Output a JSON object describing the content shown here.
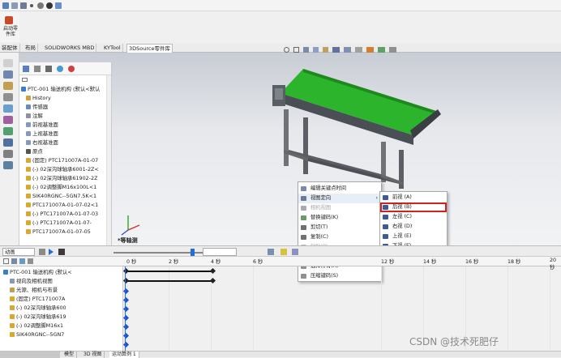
{
  "toolbar_top": {
    "toolbox_label_1": "启动零",
    "toolbox_label_2": "件库"
  },
  "tabs": [
    "装配体",
    "布局",
    "SOLIDWORKS MBD",
    "KYTool",
    "3DSource零件库"
  ],
  "feature_tree": {
    "items": [
      {
        "label": "PTC-001 输送机构 (默认<默认",
        "indent": 0
      },
      {
        "label": "History",
        "indent": 1
      },
      {
        "label": "传感器",
        "indent": 1
      },
      {
        "label": "注解",
        "indent": 1
      },
      {
        "label": "前视基准面",
        "indent": 1
      },
      {
        "label": "上视基准面",
        "indent": 1
      },
      {
        "label": "右视基准面",
        "indent": 1
      },
      {
        "label": "原点",
        "indent": 1
      },
      {
        "label": "(固定) PTC171007A-01-07",
        "indent": 1
      },
      {
        "label": "(-) 02深沟球轴承6001-2Z<",
        "indent": 1
      },
      {
        "label": "(-) 02深沟球轴承61902-2Z",
        "indent": 1
      },
      {
        "label": "(-) 02调整脚M16x100L<1",
        "indent": 1
      },
      {
        "label": "SIK40RGNC--5GN7.5K<1",
        "indent": 1
      },
      {
        "label": "PTC171007A-01-07-02<1",
        "indent": 1
      },
      {
        "label": "(-) PTC171007A-01-07-03",
        "indent": 1
      },
      {
        "label": "(-) PTC171007A-01-07-",
        "indent": 1
      },
      {
        "label": "PTC171007A-01-07-05",
        "indent": 1
      }
    ]
  },
  "viewport": {
    "view_label": "*等轴测"
  },
  "context_menu": {
    "items": [
      {
        "label": "编辑关键点时间",
        "disabled": false
      },
      {
        "label": "视图定向",
        "disabled": false,
        "submenu": true
      },
      {
        "label": "相机视图",
        "disabled": true
      },
      {
        "label": "替换键码(K)",
        "disabled": false
      },
      {
        "label": "剪切(T)",
        "disabled": false
      },
      {
        "label": "复制(C)",
        "disabled": false
      },
      {
        "label": "粘贴(P)",
        "disabled": true
      },
      {
        "label": "删除(D)",
        "disabled": false
      },
      {
        "label": "选择所有(A)",
        "disabled": false
      },
      {
        "label": "压缩键码(S)",
        "disabled": false
      }
    ]
  },
  "submenu": {
    "items": [
      {
        "label": "前视 (A)",
        "highlighted": false
      },
      {
        "label": "后视 (B)",
        "highlighted": true
      },
      {
        "label": "左视 (C)",
        "highlighted": false
      },
      {
        "label": "右视 (D)",
        "highlighted": false
      },
      {
        "label": "上视 (E)",
        "highlighted": false
      },
      {
        "label": "下视 (F)",
        "highlighted": false
      },
      {
        "label": "等轴测 (G)",
        "highlighted": false
      }
    ]
  },
  "animation": {
    "mode": "动画",
    "timeline_labels": [
      "0 秒",
      "2 秒",
      "4 秒",
      "6 秒",
      "12 秒",
      "14 秒",
      "16 秒",
      "18 秒",
      "20 秒"
    ],
    "tree_items": [
      "PTC-001 输送机构 (默认<",
      "视向及相机视图",
      "光源、相机与布景",
      "(固定) PTC171007A",
      "(-) 02深沟球轴承600",
      "(-) 02深沟球轴承619",
      "(-) 02调整脚M16x1",
      "SIK40RGNC--5GN7"
    ]
  },
  "status_tabs": [
    "模型",
    "3D 视图",
    "运动算例 1"
  ],
  "watermark": "CSDN @技术死肥仔",
  "colors": {
    "conveyor_green": "#2db42d",
    "frame_gray": "#6f7378",
    "selection_box": "#d42020",
    "playhead": "#1f6fd6"
  }
}
